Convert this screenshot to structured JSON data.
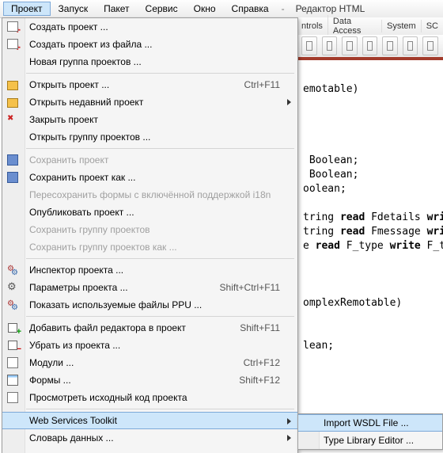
{
  "menubar": {
    "items": [
      "Проект",
      "Запуск",
      "Пакет",
      "Сервис",
      "Окно",
      "Справка"
    ],
    "dash": "-",
    "title": "Редактор HTML"
  },
  "rightTabs": [
    "ntrols",
    "Data Access",
    "System",
    "SC"
  ],
  "dropdown": {
    "new_project": "Создать проект ...",
    "new_project_file": "Создать проект из файла ...",
    "new_group": "Новая группа проектов ...",
    "open_project": "Открыть проект ...",
    "open_project_sc": "Ctrl+F11",
    "open_recent": "Открыть недавний проект",
    "close_project": "Закрыть проект",
    "open_group": "Открыть группу проектов ...",
    "save_project": "Сохранить проект",
    "save_project_as": "Сохранить проект как ...",
    "resave_i18n": "Пересохранить формы с включённой поддержкой i18n",
    "publish": "Опубликовать проект ...",
    "save_group": "Сохранить группу проектов",
    "save_group_as": "Сохранить группу проектов как ...",
    "inspector": "Инспектор проекта ...",
    "params": "Параметры проекта ...",
    "params_sc": "Shift+Ctrl+F11",
    "show_ppu": "Показать используемые файлы PPU ...",
    "add_file": "Добавить файл редактора в проект",
    "add_file_sc": "Shift+F11",
    "remove_file": "Убрать из проекта ...",
    "modules": "Модули ...",
    "modules_sc": "Ctrl+F12",
    "forms": "Формы ...",
    "forms_sc": "Shift+F12",
    "view_source": "Просмотреть исходный код проекта",
    "web_toolkit": "Web Services Toolkit",
    "data_dict": "Словарь данных ..."
  },
  "submenu": {
    "import_wsdl": "Import WSDL File ...",
    "type_lib": "Type Library Editor ..."
  },
  "code": {
    "l1": "emotable)",
    "l2": " Boolean;",
    "l3": " Boolean;",
    "l4": "oolean;",
    "l5a": "tring ",
    "l5b": "read",
    "l5c": " Fdetails ",
    "l5d": "wri",
    "l6a": "tring ",
    "l6b": "read",
    "l6c": " Fmessage ",
    "l6d": "wri",
    "l7a": "e ",
    "l7b": "read",
    "l7c": " F_type ",
    "l7d": "write",
    "l7e": " F_t",
    "l8": "omplexRemotable)",
    "l9": "lean;"
  }
}
